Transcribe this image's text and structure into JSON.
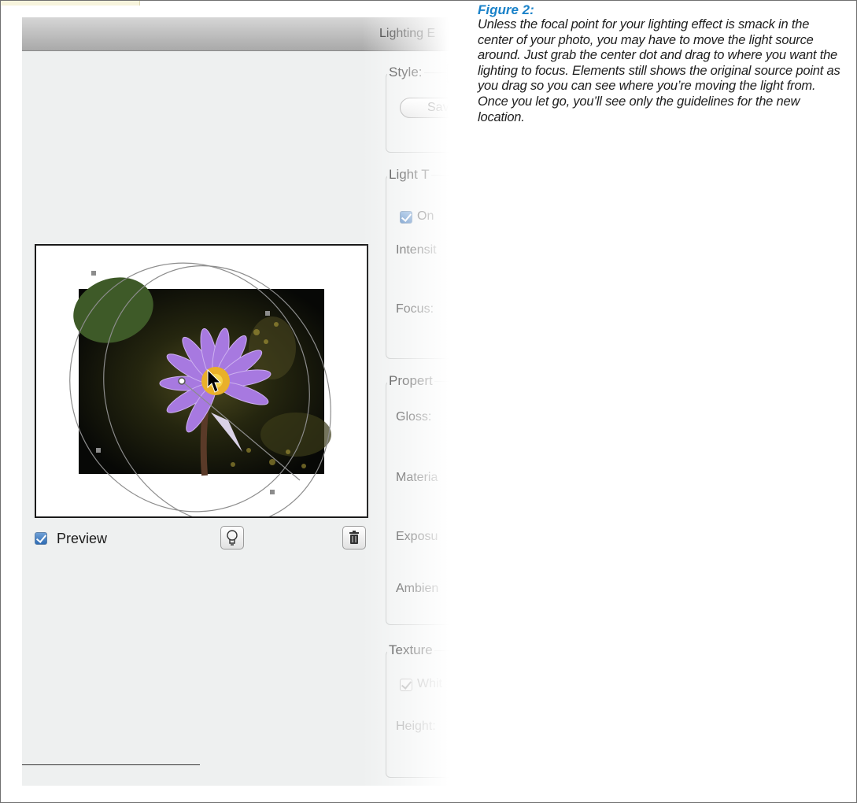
{
  "caption": {
    "figure_label": "Figure 2:",
    "body": "Unless the focal point for your lighting effect is smack in the center of your photo, you may have to move the light source around. Just grab the center dot and drag to where you want the lighting to focus. Elements still shows the original source point as you drag so you can see where you’re moving the light from. Once you let go, you’ll see only the guidelines for the new location."
  },
  "dialog": {
    "title": "Lighting E",
    "style_group": {
      "label": "Style:",
      "save_button": "Save"
    },
    "light_type_group": {
      "label": "Light T",
      "on_checkbox": {
        "label": "On",
        "checked": true
      },
      "intensity_label": "Intensit",
      "focus_label": "Focus:"
    },
    "properties_group": {
      "label": "Propert",
      "gloss_label": "Gloss:",
      "material_label": "Materia",
      "exposure_label": "Exposu",
      "ambience_label": "Ambien"
    },
    "texture_group": {
      "label": "Texture",
      "white_checkbox": {
        "label": "Whit",
        "checked": true,
        "enabled": false
      },
      "height_label": "Height:"
    },
    "preview_checkbox": {
      "label": "Preview",
      "checked": true
    },
    "icons": {
      "new_light": "lightbulb-icon",
      "delete_light": "trash-icon"
    }
  }
}
